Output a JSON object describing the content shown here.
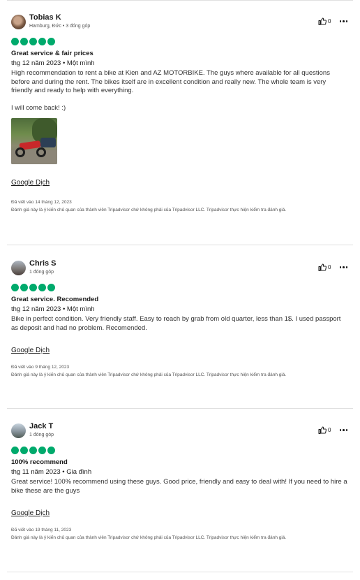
{
  "reviews": [
    {
      "name": "Tobias K",
      "meta": "Hamburg, Đức • 3 đóng góp",
      "likes": "0",
      "rating": 5,
      "title": "Great service & fair prices",
      "date_line": "thg 12 năm 2023 • Một mình",
      "body": [
        "High recommendation to rent a bike at Kien and AZ MOTORBIKE. The guys where available for all questions before and during the rent. The bikes itself are in excellent condition and really new. The whole team is very friendly and ready to help with everything.",
        "I will come back! :)"
      ],
      "translate_label": "Google Dịch",
      "written_date": "Đã viết vào 14 tháng 12, 2023",
      "disclaimer": "Đánh giá này là ý kiến chủ quan của thành viên Tripadvisor chứ không phải của Tripadvisor LLC. Tripadvisor thực hiện kiểm tra đánh giá."
    },
    {
      "name": "Chris S",
      "meta": "1 đóng góp",
      "likes": "0",
      "rating": 5,
      "title": "Great service. Recomended",
      "date_line": "thg 12 năm 2023 • Một mình",
      "body": [
        "Bike in perfect condition. Very friendly staff. Easy to reach by grab from old quarter, less than 1$. I used passport as deposit and had no problem. Recomended."
      ],
      "translate_label": "Google Dịch",
      "written_date": "Đã viết vào 9 tháng 12, 2023",
      "disclaimer": "Đánh giá này là ý kiến chủ quan của thành viên Tripadvisor chứ không phải của Tripadvisor LLC. Tripadvisor thực hiện kiểm tra đánh giá."
    },
    {
      "name": "Jack T",
      "meta": "1 đóng góp",
      "likes": "0",
      "rating": 5,
      "title": "100% recommend",
      "date_line": "thg 11 năm 2023 • Gia đình",
      "body": [
        "Great service! 100% recommend using these guys. Good price, friendly and easy to deal with! If you need to hire a bike these are the guys"
      ],
      "translate_label": "Google Dịch",
      "written_date": "Đã viết vào 19 tháng 11, 2023",
      "disclaimer": "Đánh giá này là ý kiến chủ quan của thành viên Tripadvisor chứ không phải của Tripadvisor LLC. Tripadvisor thực hiện kiểm tra đánh giá."
    }
  ],
  "colors": {
    "rating_bubble": "#00aa6c",
    "divider": "#e0e0e0"
  },
  "icons": {
    "like": "thumbs-up-icon",
    "more": "more-options-icon"
  }
}
